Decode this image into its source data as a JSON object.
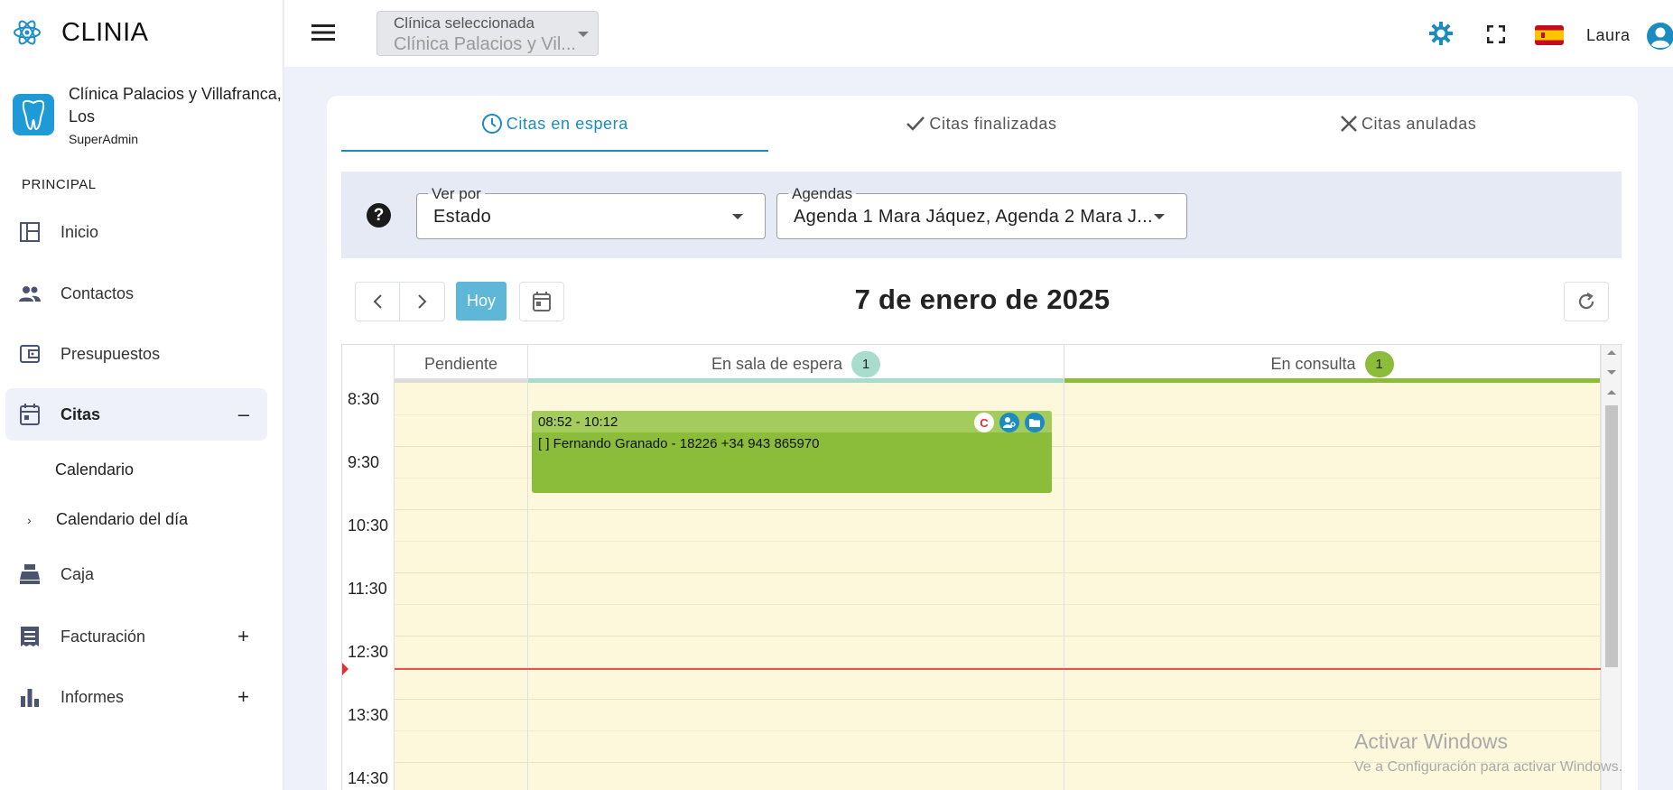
{
  "app": {
    "name": "CLINIA"
  },
  "clinic": {
    "name": "Clínica Palacios y Villafranca, Los",
    "role": "SuperAdmin"
  },
  "sidebar": {
    "section": "PRINCIPAL",
    "items": [
      {
        "label": "Inicio",
        "icon": "dashboard-icon"
      },
      {
        "label": "Contactos",
        "icon": "people-icon"
      },
      {
        "label": "Presupuestos",
        "icon": "wallet-icon"
      },
      {
        "label": "Citas",
        "icon": "calendar-icon",
        "toggle": "–"
      },
      {
        "label": "Caja",
        "icon": "cash-register-icon"
      },
      {
        "label": "Facturación",
        "icon": "receipt-icon",
        "toggle": "+"
      },
      {
        "label": "Informes",
        "icon": "bar-chart-icon",
        "toggle": "+"
      }
    ],
    "citas_sub": [
      {
        "label": "Calendario"
      },
      {
        "label": "Calendario del día",
        "chevron": "›"
      }
    ]
  },
  "topbar": {
    "clinic_select_label": "Clínica seleccionada",
    "clinic_select_value": "Clínica Palacios y Vil...",
    "user": "Laura"
  },
  "tabs": [
    {
      "label": "Citas en espera",
      "icon": "clock-icon",
      "active": true
    },
    {
      "label": "Citas finalizadas",
      "icon": "check-icon"
    },
    {
      "label": "Citas anuladas",
      "icon": "close-icon"
    }
  ],
  "filters": {
    "ver_por": {
      "label": "Ver por",
      "value": "Estado"
    },
    "agendas": {
      "label": "Agendas",
      "value": "Agenda 1 Mara Jáquez, Agenda 2 Mara J..."
    }
  },
  "toolbar": {
    "today": "Hoy",
    "date_title": "7 de enero de 2025"
  },
  "calendar": {
    "columns": [
      {
        "label": "Pendiente",
        "color": "#dcdcdc"
      },
      {
        "label": "En sala de espera",
        "count": "1",
        "color": "#a8dccd"
      },
      {
        "label": "En consulta",
        "count": "1",
        "color": "#8bbd3b"
      }
    ],
    "times": [
      "8:30",
      "9:30",
      "10:30",
      "11:30",
      "12:30",
      "13:30",
      "14:30"
    ],
    "event": {
      "time": "08:52 - 10:12",
      "text": "[ ] Fernando Granado - 18226 +34 943 865970",
      "badge": "C"
    }
  },
  "watermark": {
    "line1": "Activar Windows",
    "line2": "Ve a Configuración para activar Windows."
  }
}
